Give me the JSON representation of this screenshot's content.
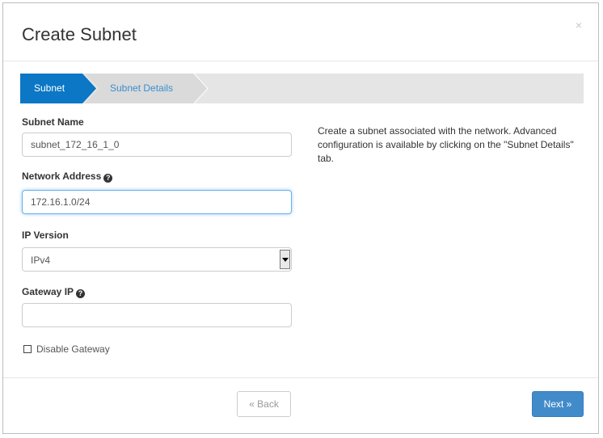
{
  "dialog": {
    "title": "Create Subnet",
    "close_label": "×"
  },
  "wizard": {
    "steps": [
      {
        "label": "Subnet",
        "active": true
      },
      {
        "label": "Subnet Details",
        "active": false
      }
    ]
  },
  "form": {
    "subnet_name": {
      "label": "Subnet Name",
      "value": "subnet_172_16_1_0"
    },
    "network_address": {
      "label": "Network Address",
      "value": "172.16.1.0/24"
    },
    "ip_version": {
      "label": "IP Version",
      "value": "IPv4"
    },
    "gateway_ip": {
      "label": "Gateway IP",
      "value": ""
    },
    "disable_gateway": {
      "label": "Disable Gateway",
      "checked": false
    },
    "help_glyph": "?"
  },
  "help_text": "Create a subnet associated with the network. Advanced configuration is available by clicking on the \"Subnet Details\" tab.",
  "footer": {
    "back_label": "« Back",
    "next_label": "Next »"
  },
  "colors": {
    "active_step": "#0b77c5",
    "inactive_step_text": "#3a8fcf",
    "primary_button": "#428bca"
  }
}
